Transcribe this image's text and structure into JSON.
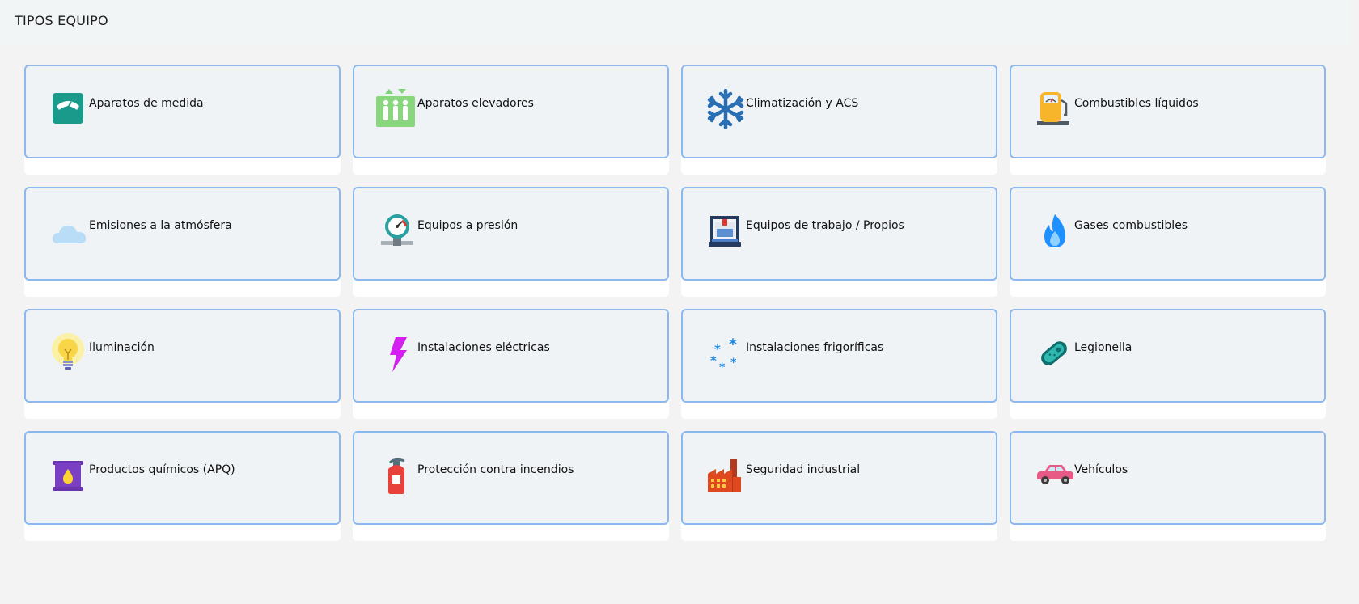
{
  "header": {
    "title": "TIPOS EQUIPO"
  },
  "cards": [
    {
      "label": "Aparatos de medida",
      "icon": "scale-icon"
    },
    {
      "label": "Aparatos elevadores",
      "icon": "elevator-icon"
    },
    {
      "label": "Climatización y ACS",
      "icon": "snowflake-icon"
    },
    {
      "label": "Combustibles líquidos",
      "icon": "fuel-pump-icon"
    },
    {
      "label": "Emisiones a la atmósfera",
      "icon": "cloud-icon"
    },
    {
      "label": "Equipos a presión",
      "icon": "pressure-gauge-icon"
    },
    {
      "label": "Equipos de trabajo / Propios",
      "icon": "3d-printer-icon"
    },
    {
      "label": "Gases combustibles",
      "icon": "flame-icon"
    },
    {
      "label": "Iluminación",
      "icon": "lightbulb-icon"
    },
    {
      "label": "Instalaciones eléctricas",
      "icon": "lightning-icon"
    },
    {
      "label": "Instalaciones frigoríficas",
      "icon": "snowflakes-icon"
    },
    {
      "label": "Legionella",
      "icon": "bacteria-icon"
    },
    {
      "label": "Productos químicos (APQ)",
      "icon": "chemical-barrel-icon"
    },
    {
      "label": "Protección contra incendios",
      "icon": "fire-extinguisher-icon"
    },
    {
      "label": "Seguridad industrial",
      "icon": "factory-icon"
    },
    {
      "label": "Vehículos",
      "icon": "car-icon"
    }
  ]
}
